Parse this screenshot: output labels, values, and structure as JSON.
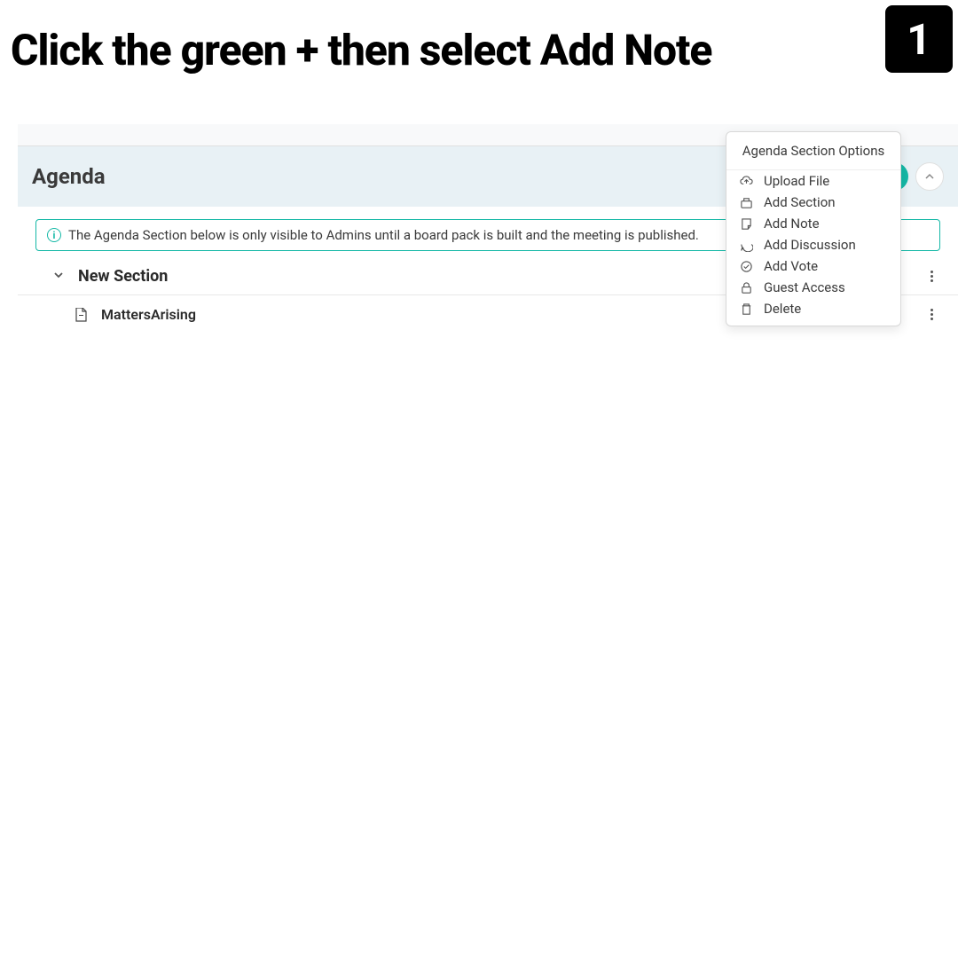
{
  "instruction": "Click the green + then select Add Note",
  "step_number": "1",
  "agenda": {
    "title": "Agenda",
    "info_message": "The Agenda Section below is only visible to Admins until a board pack is built and the meeting is published.",
    "section": {
      "title": "New Section",
      "items": [
        {
          "title": "MattersArising"
        }
      ]
    }
  },
  "dropdown": {
    "title": "Agenda Section Options",
    "items": [
      {
        "label": "Upload File",
        "icon": "cloud-upload"
      },
      {
        "label": "Add Section",
        "icon": "section"
      },
      {
        "label": "Add Note",
        "icon": "note"
      },
      {
        "label": "Add Discussion",
        "icon": "discussion"
      },
      {
        "label": "Add Vote",
        "icon": "vote"
      },
      {
        "label": "Guest Access",
        "icon": "lock"
      },
      {
        "label": "Delete",
        "icon": "trash"
      }
    ]
  },
  "colors": {
    "accent": "#14b8a6",
    "header_bg": "#e8f1f5"
  }
}
